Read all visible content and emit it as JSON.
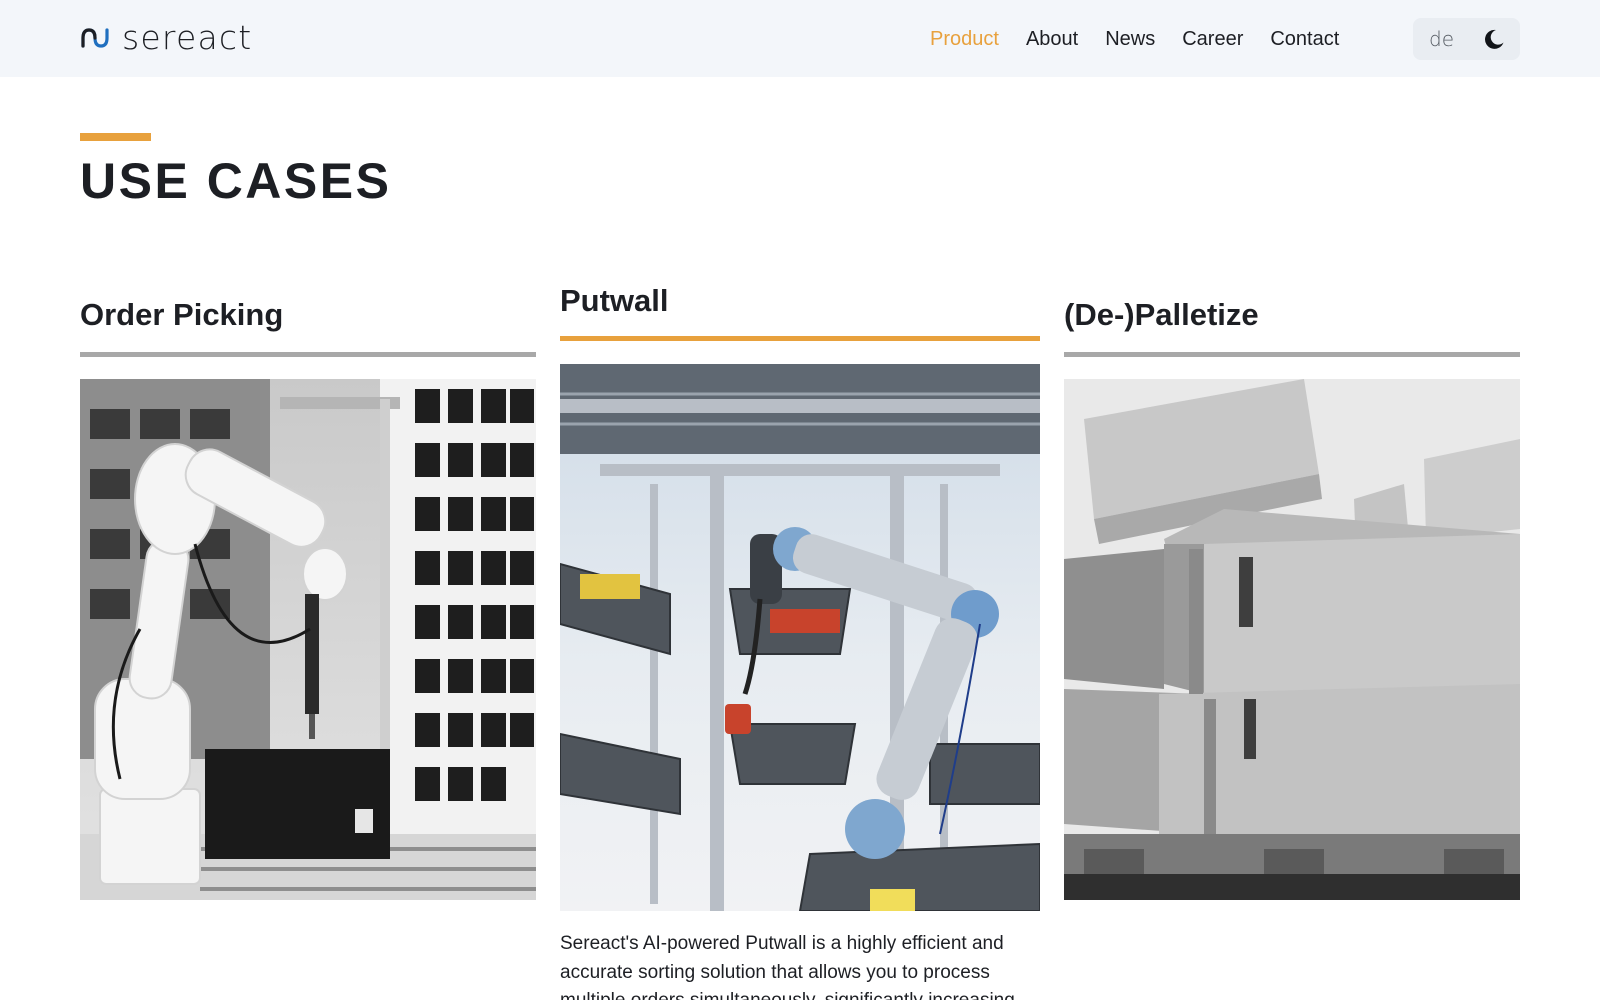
{
  "header": {
    "logo_text": "sereact",
    "nav": [
      {
        "label": "Product",
        "active": true
      },
      {
        "label": "About",
        "active": false
      },
      {
        "label": "News",
        "active": false
      },
      {
        "label": "Career",
        "active": false
      },
      {
        "label": "Contact",
        "active": false
      }
    ],
    "language": "de",
    "theme_icon": "moon-icon"
  },
  "section": {
    "title": "USE CASES"
  },
  "use_cases": [
    {
      "title": "Order Picking",
      "selected": false,
      "image": "robot-arm-picking-photo"
    },
    {
      "title": "Putwall",
      "selected": true,
      "image": "robot-arm-putwall-photo",
      "description": "Sereact's AI-powered Putwall is a highly efficient and accurate sorting solution that allows you to process multiple orders simultaneously, significantly increasing"
    },
    {
      "title": "(De-)Palletize",
      "selected": false,
      "image": "boxes-on-pallet-photo"
    }
  ],
  "colors": {
    "accent": "#e8a13d",
    "header_bg": "#f3f6fa",
    "inactive_rule": "#a8a8a8",
    "text": "#1d1f24"
  }
}
